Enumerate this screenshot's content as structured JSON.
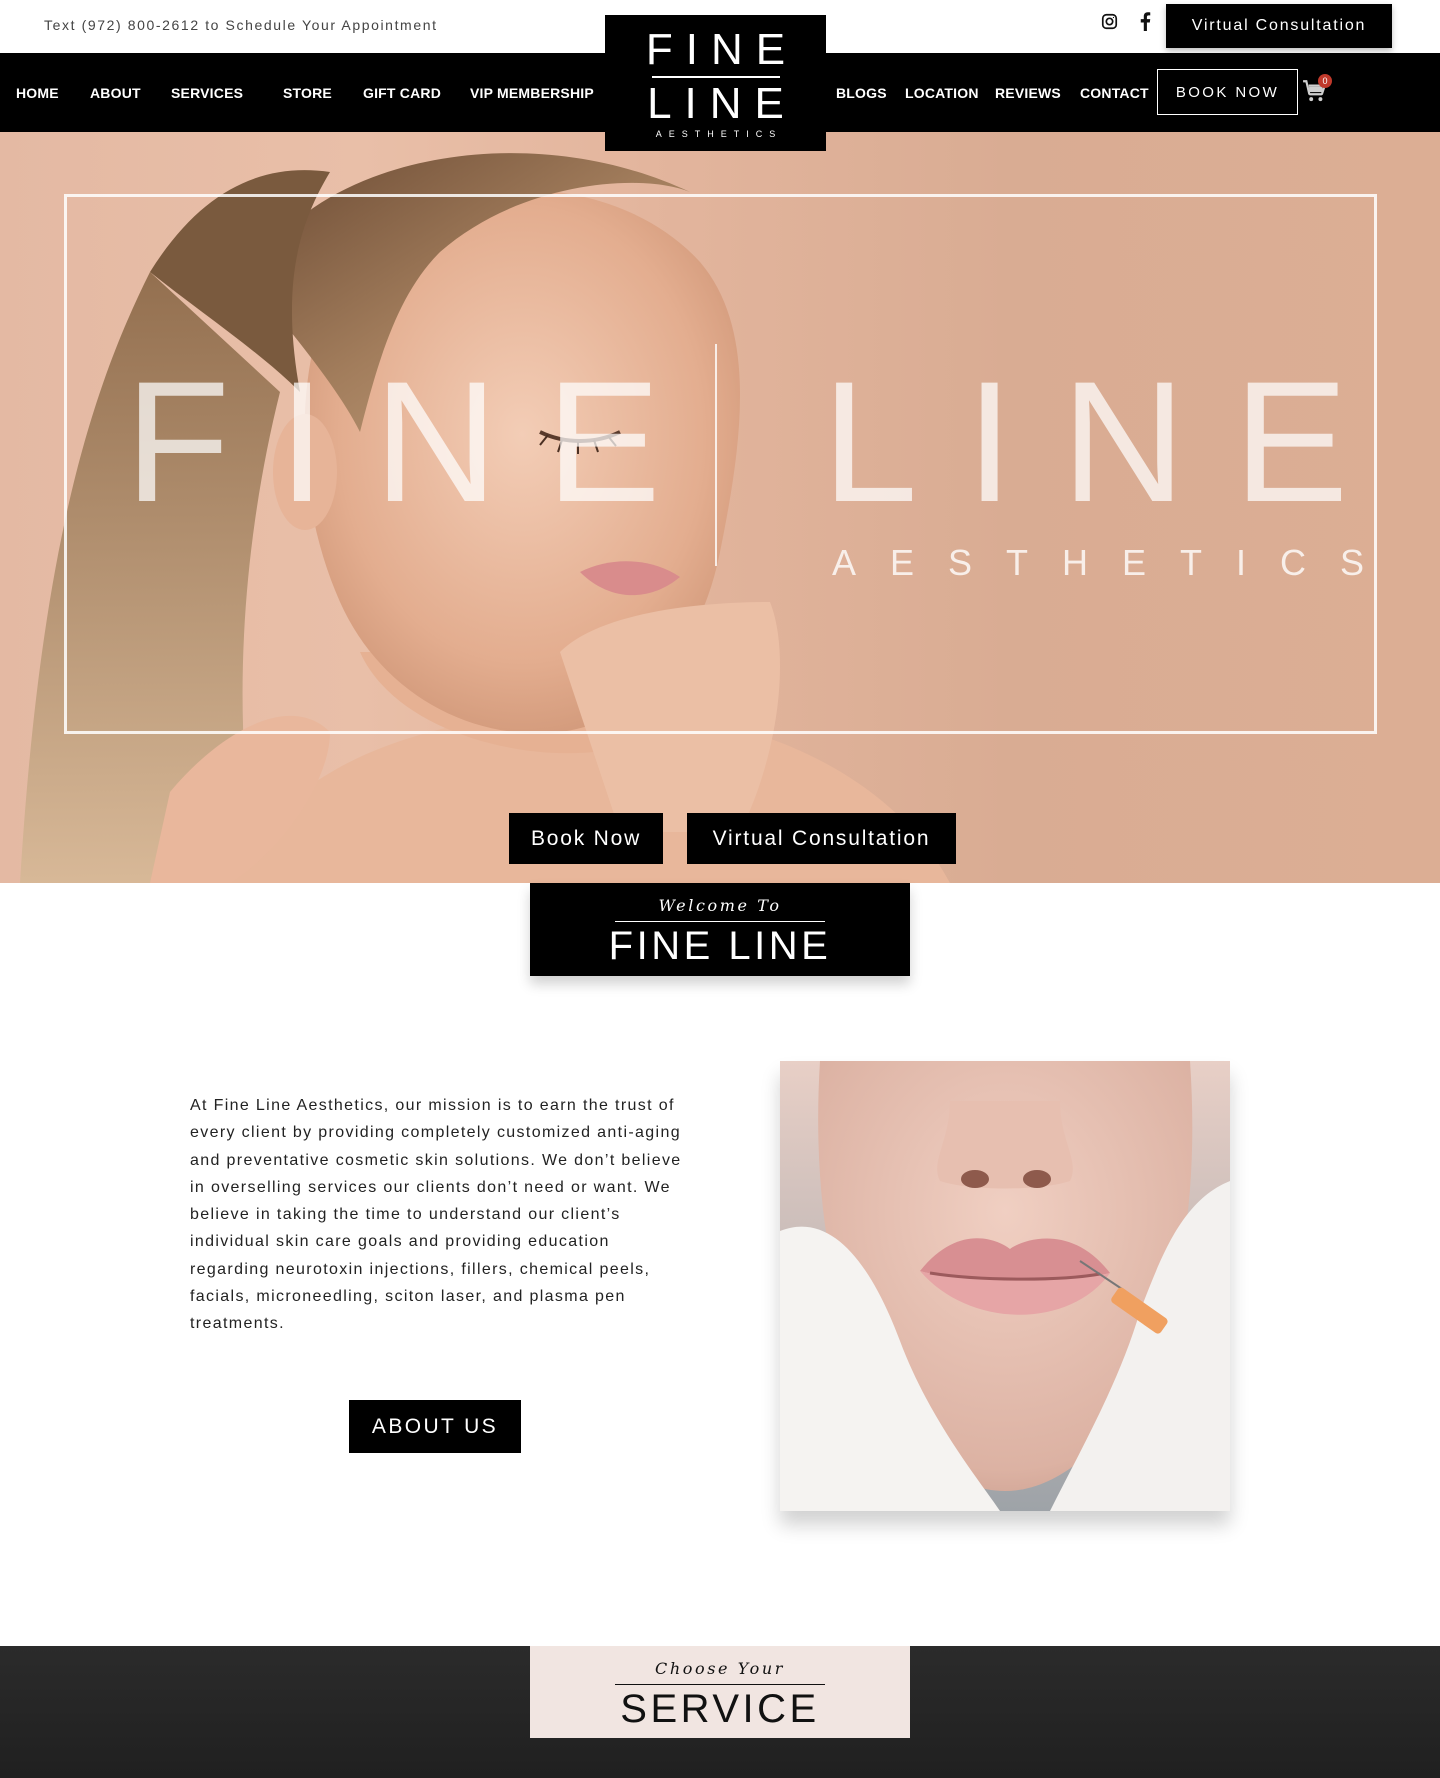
{
  "topbar": {
    "text": "Text (972) 800-2612 to Schedule Your Appointment",
    "virtual_label": "Virtual Consultation",
    "instagram_icon": "instagram-icon",
    "facebook_icon": "facebook-icon"
  },
  "nav": {
    "items_left": [
      "HOME",
      "ABOUT",
      "SERVICES",
      "STORE",
      "GIFT CARD",
      "VIP MEMBERSHIP"
    ],
    "items_right": [
      "BLOGS",
      "LOCATION",
      "REVIEWS",
      "CONTACT"
    ],
    "book_label": "BOOK NOW",
    "cart_count": "0",
    "cart_icon": "cart-icon"
  },
  "logo": {
    "line1": "FINE",
    "line2": "LINE",
    "sub": "AESTHETICS"
  },
  "hero": {
    "word1": "FINE",
    "word2": "LINE",
    "sub": "AESTHETICS",
    "book_label": "Book Now",
    "virtual_label": "Virtual Consultation"
  },
  "welcome": {
    "small": "Welcome To",
    "big": "FINE LINE"
  },
  "about": {
    "text": "At Fine Line Aesthetics, our mission is to earn the trust of every client by providing completely customized anti-aging and preventative cosmetic skin solutions. We don’t believe in overselling services our clients don’t need or want. We believe in taking the time to understand our client’s individual skin care goals and providing education regarding neurotoxin injections, fillers, chemical peels, facials, microneedling, sciton laser, and plasma pen treatments.",
    "button_label": "ABOUT US"
  },
  "service": {
    "small": "Choose Your",
    "big": "SERVICE"
  },
  "colors": {
    "brand_black": "#000000",
    "hero_peach": "#e4b9a3",
    "service_box": "#f1e5e1",
    "cart_badge": "#c0392b"
  }
}
